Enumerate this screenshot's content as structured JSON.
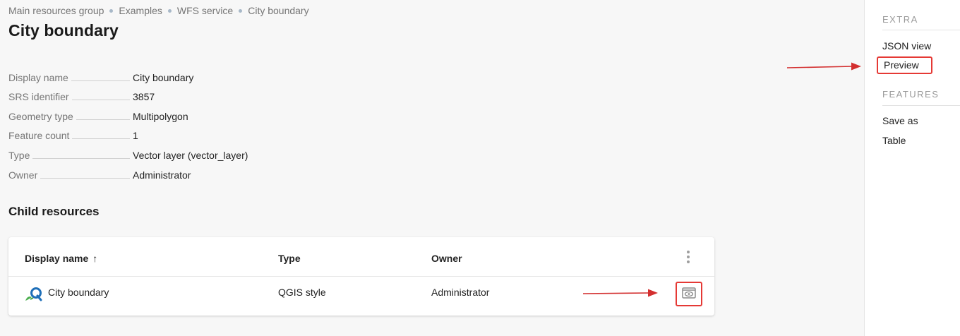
{
  "breadcrumb": [
    "Main resources group",
    "Examples",
    "WFS service",
    "City boundary"
  ],
  "page_title": "City boundary",
  "properties": [
    {
      "label": "Display name",
      "value": "City boundary"
    },
    {
      "label": "SRS identifier",
      "value": "3857"
    },
    {
      "label": "Geometry type",
      "value": "Multipolygon"
    },
    {
      "label": "Feature count",
      "value": "1"
    },
    {
      "label": "Type",
      "value": "Vector layer (vector_layer)"
    },
    {
      "label": "Owner",
      "value": "Administrator"
    }
  ],
  "child_resources": {
    "title": "Child resources",
    "columns": {
      "display_name": "Display name",
      "type": "Type",
      "owner": "Owner"
    },
    "sort_icon": "arrow-up-icon",
    "menu_icon": "more-vertical-icon",
    "rows": [
      {
        "display_name": "City boundary",
        "type": "QGIS style",
        "owner": "Administrator",
        "icon": "qgis-icon",
        "action_icon": "preview-eye-icon"
      }
    ]
  },
  "sidebar": {
    "extra_header": "EXTRA",
    "extra_items": [
      "JSON view",
      "Preview"
    ],
    "features_header": "FEATURES",
    "features_items": [
      "Save as",
      "Table"
    ]
  },
  "colors": {
    "highlight": "#e53935",
    "annotation_arrow": "#d32f2f",
    "breadcrumb_separator": "#a7b8c8"
  }
}
